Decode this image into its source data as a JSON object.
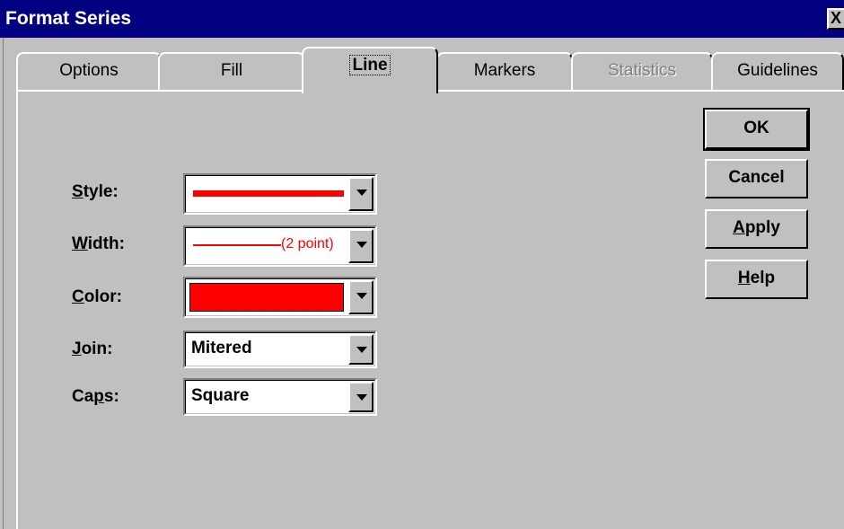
{
  "window": {
    "title": "Format Series",
    "close_glyph": "X"
  },
  "tabs": [
    {
      "label": "Options"
    },
    {
      "label": "Fill"
    },
    {
      "label": "Line"
    },
    {
      "label": "Markers"
    },
    {
      "label": "Statistics"
    },
    {
      "label": "Guidelines"
    }
  ],
  "active_tab": "Line",
  "fields": {
    "style": {
      "label_mnemonic": "S",
      "label_rest": "tyle:"
    },
    "width": {
      "label_mnemonic": "W",
      "label_rest": "idth:",
      "value": "(2 point)"
    },
    "color": {
      "label_mnemonic": "C",
      "label_rest": "olor:",
      "swatch": "#ff0000"
    },
    "join": {
      "label_mnemonic": "J",
      "label_rest": "oin:",
      "value": "Mitered"
    },
    "caps": {
      "label_pre": "Ca",
      "label_mnemonic": "p",
      "label_rest": "s:",
      "value": "Square"
    }
  },
  "buttons": {
    "ok": "OK",
    "cancel": "Cancel",
    "apply_mnemonic": "A",
    "apply_rest": "pply",
    "help_mnemonic": "H",
    "help_rest": "elp"
  },
  "colors": {
    "titlebar": "#000080",
    "face": "#c0c0c0",
    "line_color": "#ff0000"
  }
}
